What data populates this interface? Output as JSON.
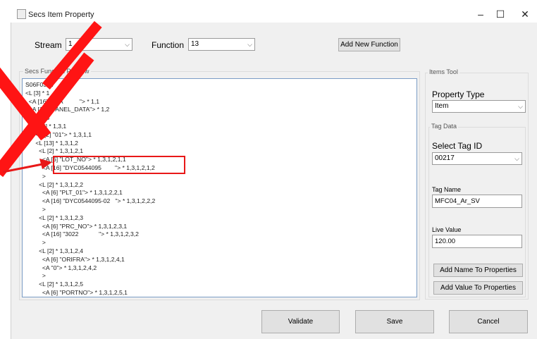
{
  "window": {
    "title": "Secs Item Property",
    "minimize": "–",
    "maximize": "☐",
    "close": "✕"
  },
  "header": {
    "stream_label": "Stream",
    "stream_value": "1",
    "function_label": "Function",
    "function_value": "13",
    "add_function_button": "Add New Function"
  },
  "preview": {
    "group_title": "Secs Function Preview",
    "lines": [
      "S06F03 W",
      "<L [3] * 1",
      "  <A [16] \"ELA          \"> * 1,1",
      "  <A [10] \"PANEL_DATA\"> * 1,2",
      "  <L * 1,3",
      "    <L [2] * 1,3,1",
      "      <A [2] \"01\"> * 1,3,1,1",
      "      <L [13] * 1,3,1,2",
      "        <L [2] * 1,3,1,2,1",
      "          <A [6] \"LOT_NO\"> * 1,3,1,2,1,1",
      "          <A [16] \"DYC0544095        \"> * 1,3,1,2,1,2",
      "          >",
      "        <L [2] * 1,3,1,2,2",
      "          <A [6] \"PLT_01\"> * 1,3,1,2,2,1",
      "          <A [16] \"DYC0544095-02   \"> * 1,3,1,2,2,2",
      "          >",
      "        <L [2] * 1,3,1,2,3",
      "          <A [6] \"PRC_NO\"> * 1,3,1,2,3,1",
      "          <A [16] \"3022            \"> * 1,3,1,2,3,2",
      "          >",
      "        <L [2] * 1,3,1,2,4",
      "          <A [6] \"ORIFRA\"> * 1,3,1,2,4,1",
      "          <A \"0\"> * 1,3,1,2,4,2",
      "          >",
      "        <L [2] * 1,3,1,2,5",
      "          <A [6] \"PORTNO\"> * 1,3,1,2,5,1"
    ]
  },
  "items_tool": {
    "group_title": "Items Tool",
    "property_type_label": "Property Type",
    "property_type_value": "Item",
    "tag_data_title": "Tag Data",
    "select_tag_label": "Select Tag ID",
    "select_tag_value": "00217",
    "tag_name_label": "Tag Name",
    "tag_name_value": "MFC04_Ar_SV",
    "live_value_label": "Live Value",
    "live_value_value": "120.00",
    "add_name_button": "Add Name To Properties",
    "add_value_button": "Add Value To Properties"
  },
  "footer": {
    "validate": "Validate",
    "save": "Save",
    "cancel": "Cancel"
  },
  "colors": {
    "annotation": "#ff1414",
    "preview_border": "#7a9cc5"
  }
}
